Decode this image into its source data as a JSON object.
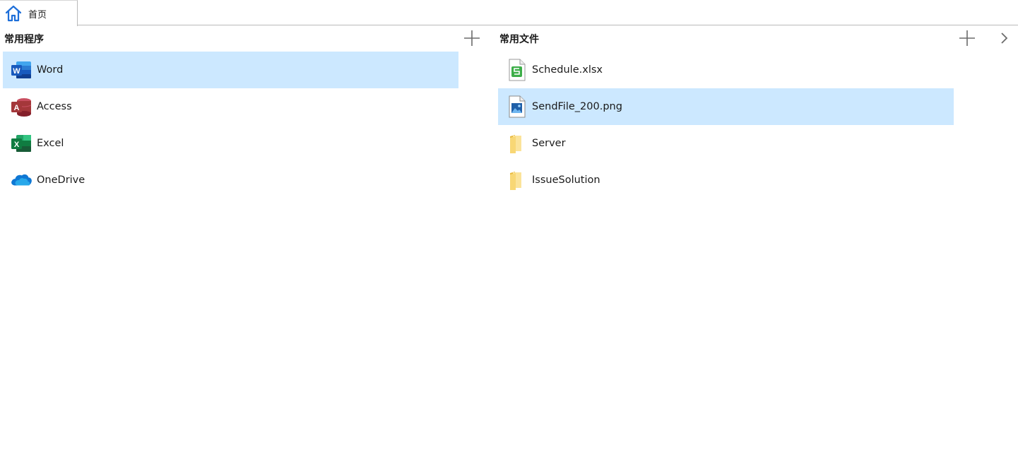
{
  "tabs": [
    {
      "label": "首页",
      "icon": "home-icon",
      "active": true
    }
  ],
  "programs": {
    "title": "常用程序",
    "add_icon": "plus-icon",
    "items": [
      {
        "label": "Word",
        "icon": "word-icon",
        "selected": true
      },
      {
        "label": "Access",
        "icon": "access-icon",
        "selected": false
      },
      {
        "label": "Excel",
        "icon": "excel-icon",
        "selected": false
      },
      {
        "label": "OneDrive",
        "icon": "onedrive-icon",
        "selected": false
      }
    ]
  },
  "files": {
    "title": "常用文件",
    "add_icon": "plus-icon",
    "more_icon": "chevron-right-icon",
    "items": [
      {
        "label": "Schedule.xlsx",
        "icon": "spreadsheet-file-icon",
        "selected": false
      },
      {
        "label": "SendFile_200.png",
        "icon": "image-file-icon",
        "selected": true
      },
      {
        "label": "Server",
        "icon": "folder-icon",
        "selected": false
      },
      {
        "label": "IssueSolution",
        "icon": "folder-icon",
        "selected": false
      }
    ]
  },
  "colors": {
    "selection": "#cce8ff",
    "home_icon": "#1e6fd9",
    "word": "#185abd",
    "access": "#a4373a",
    "excel": "#107c41",
    "onedrive": "#0f78d4",
    "folder": "#f8d775"
  }
}
